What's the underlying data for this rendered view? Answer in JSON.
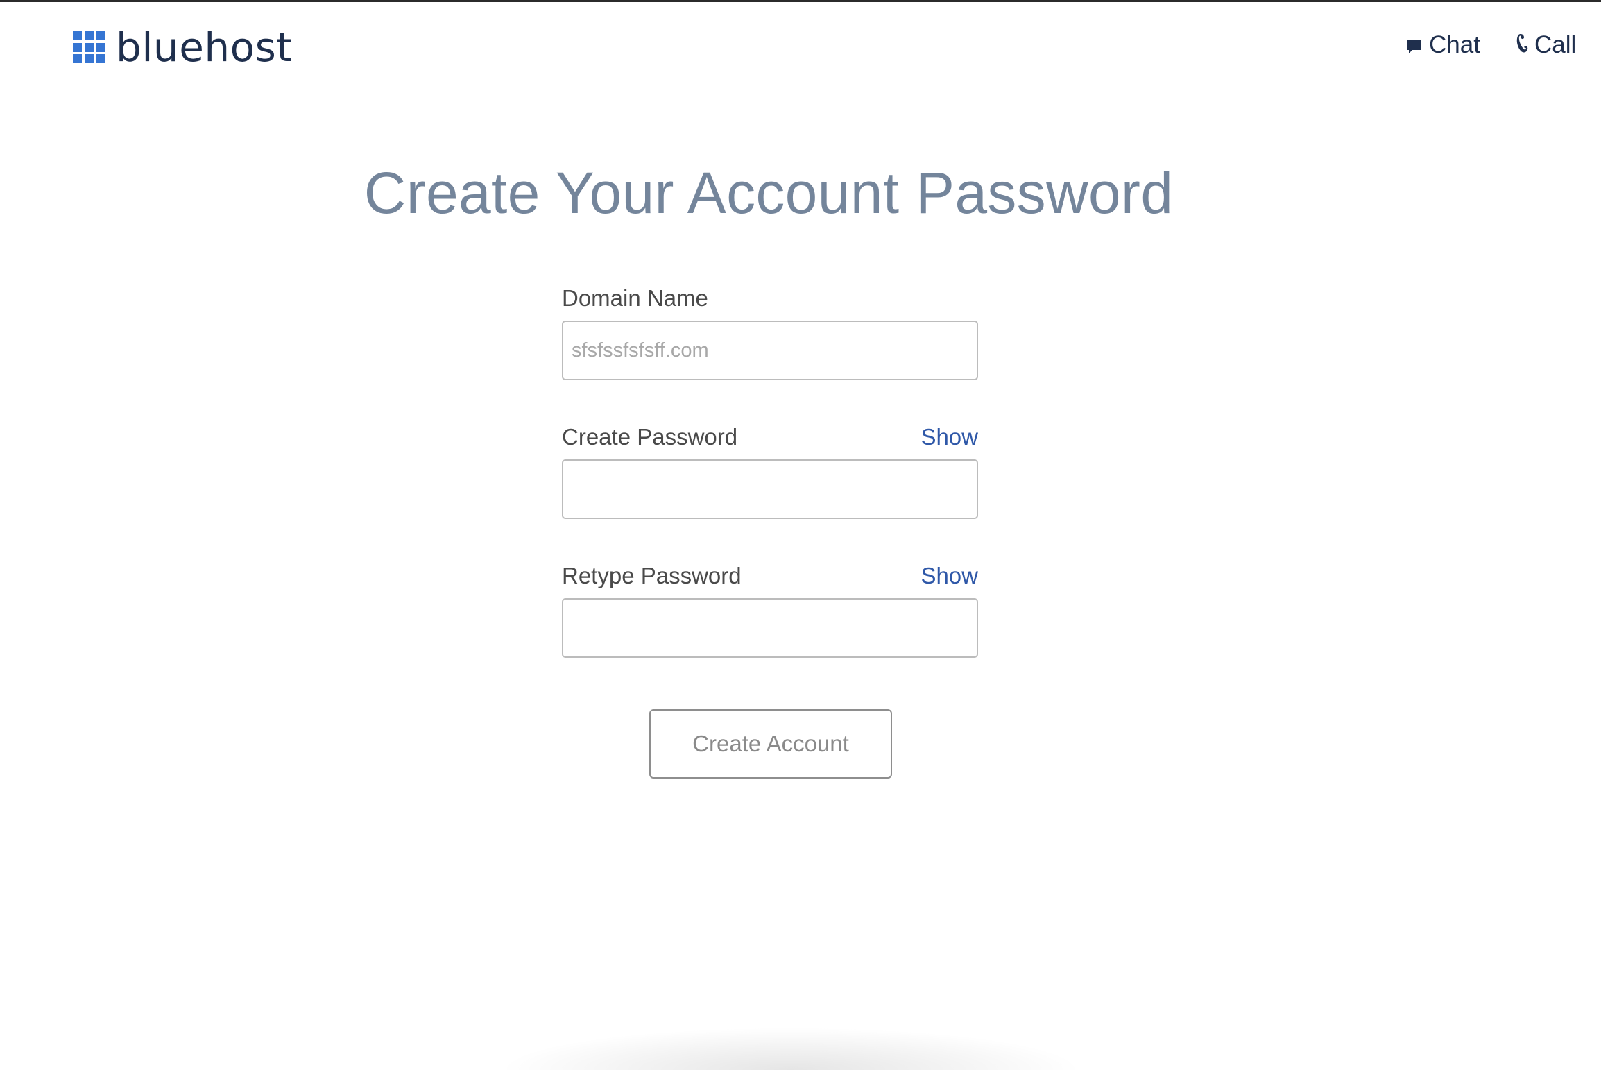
{
  "header": {
    "logo_text": "bluehost",
    "chat_label": "Chat",
    "call_label": "Call"
  },
  "main": {
    "title": "Create Your Account Password",
    "domain_field": {
      "label": "Domain Name",
      "placeholder": "sfsfssfsfsff.com"
    },
    "password_field": {
      "label": "Create Password",
      "show_label": "Show",
      "value": ""
    },
    "retype_field": {
      "label": "Retype Password",
      "show_label": "Show",
      "value": ""
    },
    "submit_label": "Create Account"
  },
  "colors": {
    "brand_blue": "#3575d3",
    "navy_text": "#1f2f4d",
    "title_gray": "#74859b",
    "link_blue": "#2f58a8"
  },
  "icons": {
    "logo": "grid-logo-icon",
    "chat": "chat-bubble-icon",
    "call": "phone-icon"
  }
}
